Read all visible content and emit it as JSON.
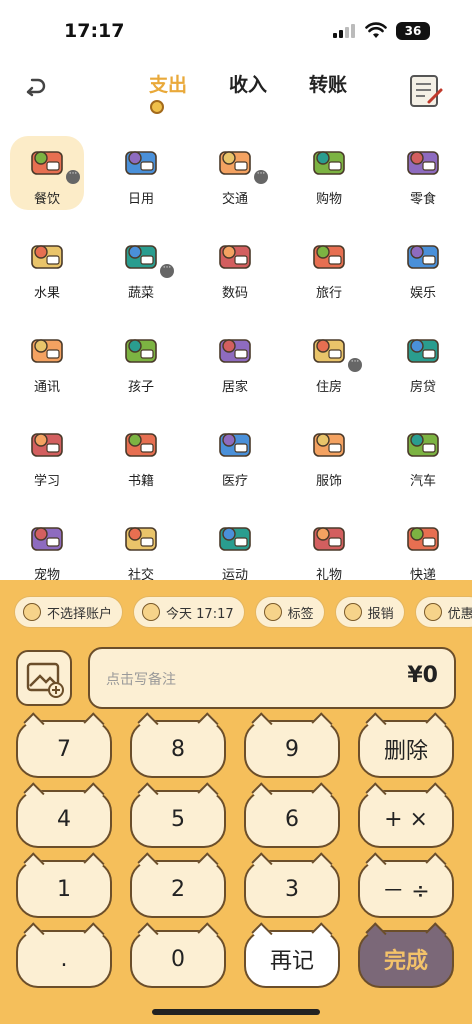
{
  "status": {
    "time": "17:17",
    "battery": "36"
  },
  "header": {
    "tabs": [
      {
        "label": "支出",
        "active": true
      },
      {
        "label": "收入",
        "active": false
      },
      {
        "label": "转账",
        "active": false
      }
    ]
  },
  "categories": [
    {
      "label": "餐饮",
      "icon": "dining-icon",
      "selected": true,
      "more": true
    },
    {
      "label": "日用",
      "icon": "daily-goods-icon"
    },
    {
      "label": "交通",
      "icon": "bus-icon",
      "more": true
    },
    {
      "label": "购物",
      "icon": "shopping-cart-icon"
    },
    {
      "label": "零食",
      "icon": "snack-icon"
    },
    {
      "label": "水果",
      "icon": "fruit-icon"
    },
    {
      "label": "蔬菜",
      "icon": "vegetable-icon",
      "more": true
    },
    {
      "label": "数码",
      "icon": "computer-icon"
    },
    {
      "label": "旅行",
      "icon": "luggage-icon"
    },
    {
      "label": "娱乐",
      "icon": "juggler-icon"
    },
    {
      "label": "通讯",
      "icon": "globe-icon"
    },
    {
      "label": "孩子",
      "icon": "baby-icon"
    },
    {
      "label": "居家",
      "icon": "cabinet-icon"
    },
    {
      "label": "住房",
      "icon": "house-icon",
      "more": true
    },
    {
      "label": "房贷",
      "icon": "mortgage-house-icon"
    },
    {
      "label": "学习",
      "icon": "study-icon"
    },
    {
      "label": "书籍",
      "icon": "books-icon"
    },
    {
      "label": "医疗",
      "icon": "medical-kit-icon"
    },
    {
      "label": "服饰",
      "icon": "dress-icon"
    },
    {
      "label": "汽车",
      "icon": "car-icon"
    },
    {
      "label": "宠物",
      "icon": "dog-icon"
    },
    {
      "label": "社交",
      "icon": "cheers-icon"
    },
    {
      "label": "运动",
      "icon": "soccer-icon"
    },
    {
      "label": "礼物",
      "icon": "gift-balloon-icon"
    },
    {
      "label": "快递",
      "icon": "courier-icon"
    }
  ],
  "chips": [
    {
      "label": "不选择账户",
      "icon": "wallet-icon"
    },
    {
      "label": "今天 17:17",
      "icon": "calendar-icon"
    },
    {
      "label": "标签",
      "icon": "tag-icon"
    },
    {
      "label": "报销",
      "icon": "reimburse-icon"
    },
    {
      "label": "优惠",
      "icon": "discount-icon"
    }
  ],
  "note": {
    "placeholder": "点击写备注",
    "amount": "¥0"
  },
  "keypad": [
    {
      "label": "7"
    },
    {
      "label": "8"
    },
    {
      "label": "9"
    },
    {
      "label": "删除"
    },
    {
      "label": "4"
    },
    {
      "label": "5"
    },
    {
      "label": "6"
    },
    {
      "label": "+ ×"
    },
    {
      "label": "1"
    },
    {
      "label": "2"
    },
    {
      "label": "3"
    },
    {
      "label": "－ ÷"
    },
    {
      "label": "."
    },
    {
      "label": "0"
    },
    {
      "label": "再记",
      "style": "white"
    },
    {
      "label": "完成",
      "style": "dark"
    }
  ],
  "colors": {
    "accent": "#e9a93a",
    "panel": "#f5bf5b",
    "key": "#fcefd3",
    "done": "#7b6878"
  }
}
